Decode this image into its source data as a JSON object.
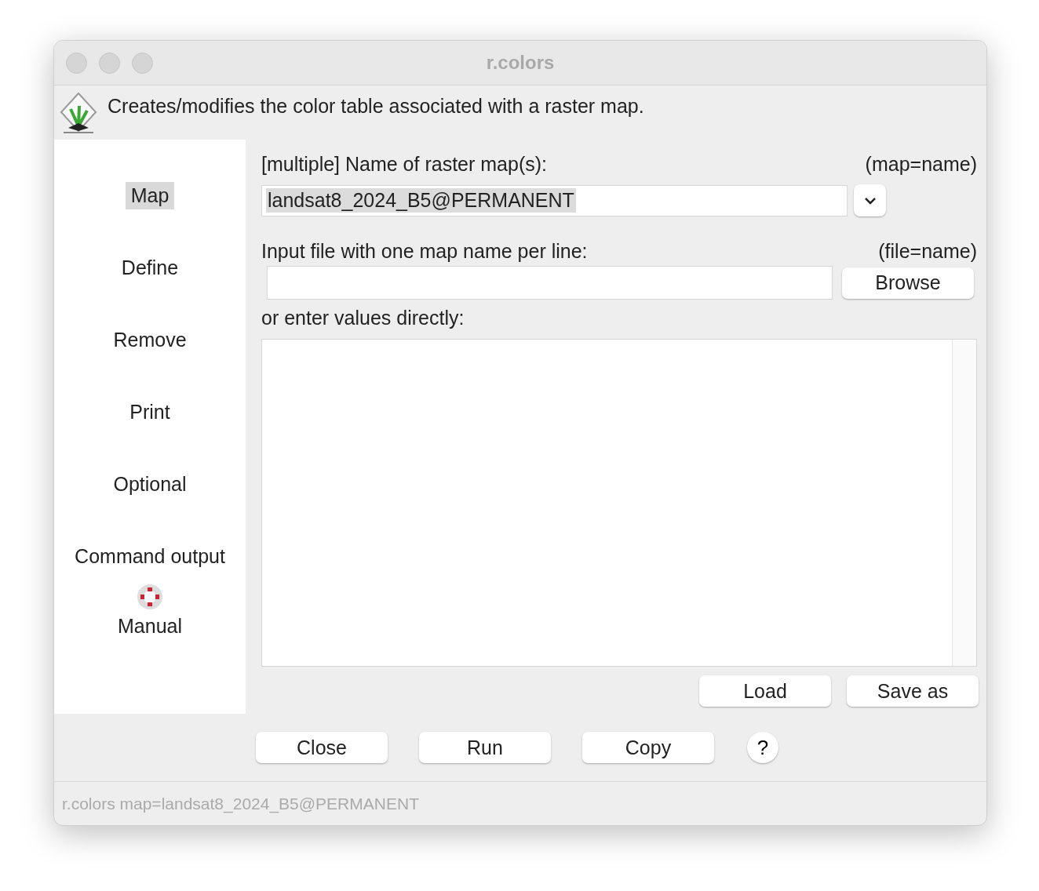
{
  "window": {
    "title": "r.colors"
  },
  "description": "Creates/modifies the color table associated with a raster map.",
  "sidebar": {
    "items": [
      {
        "label": "Map",
        "selected": true
      },
      {
        "label": "Define",
        "selected": false
      },
      {
        "label": "Remove",
        "selected": false
      },
      {
        "label": "Print",
        "selected": false
      },
      {
        "label": "Optional",
        "selected": false
      },
      {
        "label": "Command output",
        "selected": false
      },
      {
        "label": "Manual",
        "selected": false,
        "kind": "help"
      }
    ]
  },
  "map_field": {
    "label": "[multiple] Name of raster map(s):",
    "param": "(map=name)",
    "value": "landsat8_2024_B5@PERMANENT",
    "text_selected": true
  },
  "file_field": {
    "label": "Input file with one map name per line:",
    "param": "(file=name)",
    "button": "Browse"
  },
  "values_area": {
    "label": "or enter values directly:",
    "buttons": [
      "Load",
      "Save as"
    ]
  },
  "buttons": [
    "Close",
    "Run",
    "Copy"
  ],
  "help_button": "?",
  "status_bar": "r.colors map=landsat8_2024_B5@PERMANENT"
}
